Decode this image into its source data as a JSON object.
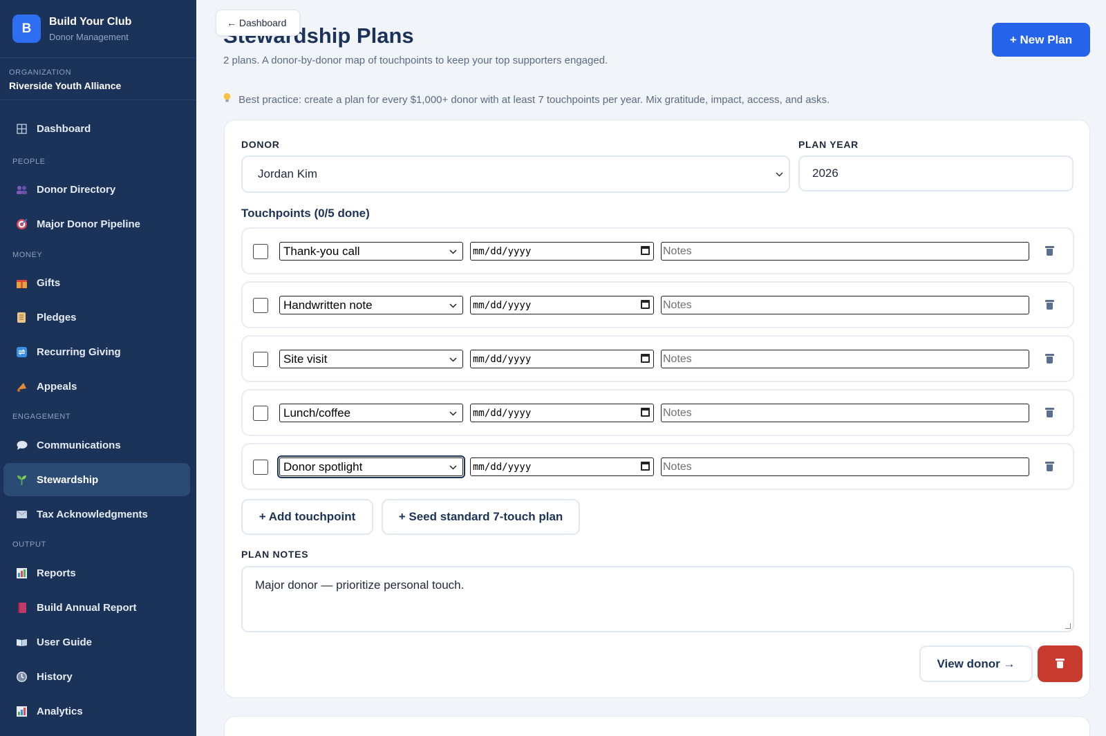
{
  "sidebar": {
    "brand_initial": "B",
    "brand_title": "Build Your Club",
    "brand_subtitle": "Donor Management",
    "org_label": "ORGANIZATION",
    "org_name": "Riverside Youth Alliance",
    "dashboard": "Dashboard",
    "sections": {
      "people": "PEOPLE",
      "money": "MONEY",
      "engagement": "ENGAGEMENT",
      "output": "OUTPUT"
    },
    "items": {
      "donor_directory": "Donor Directory",
      "major_donor_pipeline": "Major Donor Pipeline",
      "gifts": "Gifts",
      "pledges": "Pledges",
      "recurring_giving": "Recurring Giving",
      "appeals": "Appeals",
      "communications": "Communications",
      "stewardship": "Stewardship",
      "tax_acknowledgments": "Tax Acknowledgments",
      "reports": "Reports",
      "build_annual_report": "Build Annual Report",
      "user_guide": "User Guide",
      "history": "History",
      "analytics": "Analytics"
    },
    "active_item": "stewardship"
  },
  "header": {
    "back_label": "← Dashboard",
    "title": "Stewardship Plans",
    "subtitle": "2 plans. A donor-by-donor map of touchpoints to keep your top supporters engaged.",
    "new_plan_label": "+ New Plan",
    "tip": "Best practice: create a plan for every $1,000+ donor with at least 7 touchpoints per year. Mix gratitude, impact, access, and asks."
  },
  "plan": {
    "donor_label": "DONOR",
    "donor_value": "Jordan Kim",
    "year_label": "PLAN YEAR",
    "year_value": "2026",
    "touchpoints_title": "Touchpoints (0/5 done)",
    "touchpoints": [
      {
        "type": "Thank-you call",
        "date_placeholder": "mm/dd/yyyy",
        "notes_placeholder": "Notes",
        "done": false
      },
      {
        "type": "Handwritten note",
        "date_placeholder": "mm/dd/yyyy",
        "notes_placeholder": "Notes",
        "done": false
      },
      {
        "type": "Site visit",
        "date_placeholder": "mm/dd/yyyy",
        "notes_placeholder": "Notes",
        "done": false
      },
      {
        "type": "Lunch/coffee",
        "date_placeholder": "mm/dd/yyyy",
        "notes_placeholder": "Notes",
        "done": false
      },
      {
        "type": "Donor spotlight",
        "date_placeholder": "mm/dd/yyyy",
        "notes_placeholder": "Notes",
        "done": false
      }
    ],
    "add_touchpoint_label": "+ Add touchpoint",
    "seed_label": "+ Seed standard 7-touch plan",
    "notes_label": "PLAN NOTES",
    "notes_value": "Major donor — prioritize personal touch.",
    "view_donor_label": "View donor →"
  },
  "colors": {
    "sidebar_bg": "#1b3358",
    "accent": "#2563eb",
    "danger": "#c93a2e",
    "active_nav": "#2b4a74"
  }
}
